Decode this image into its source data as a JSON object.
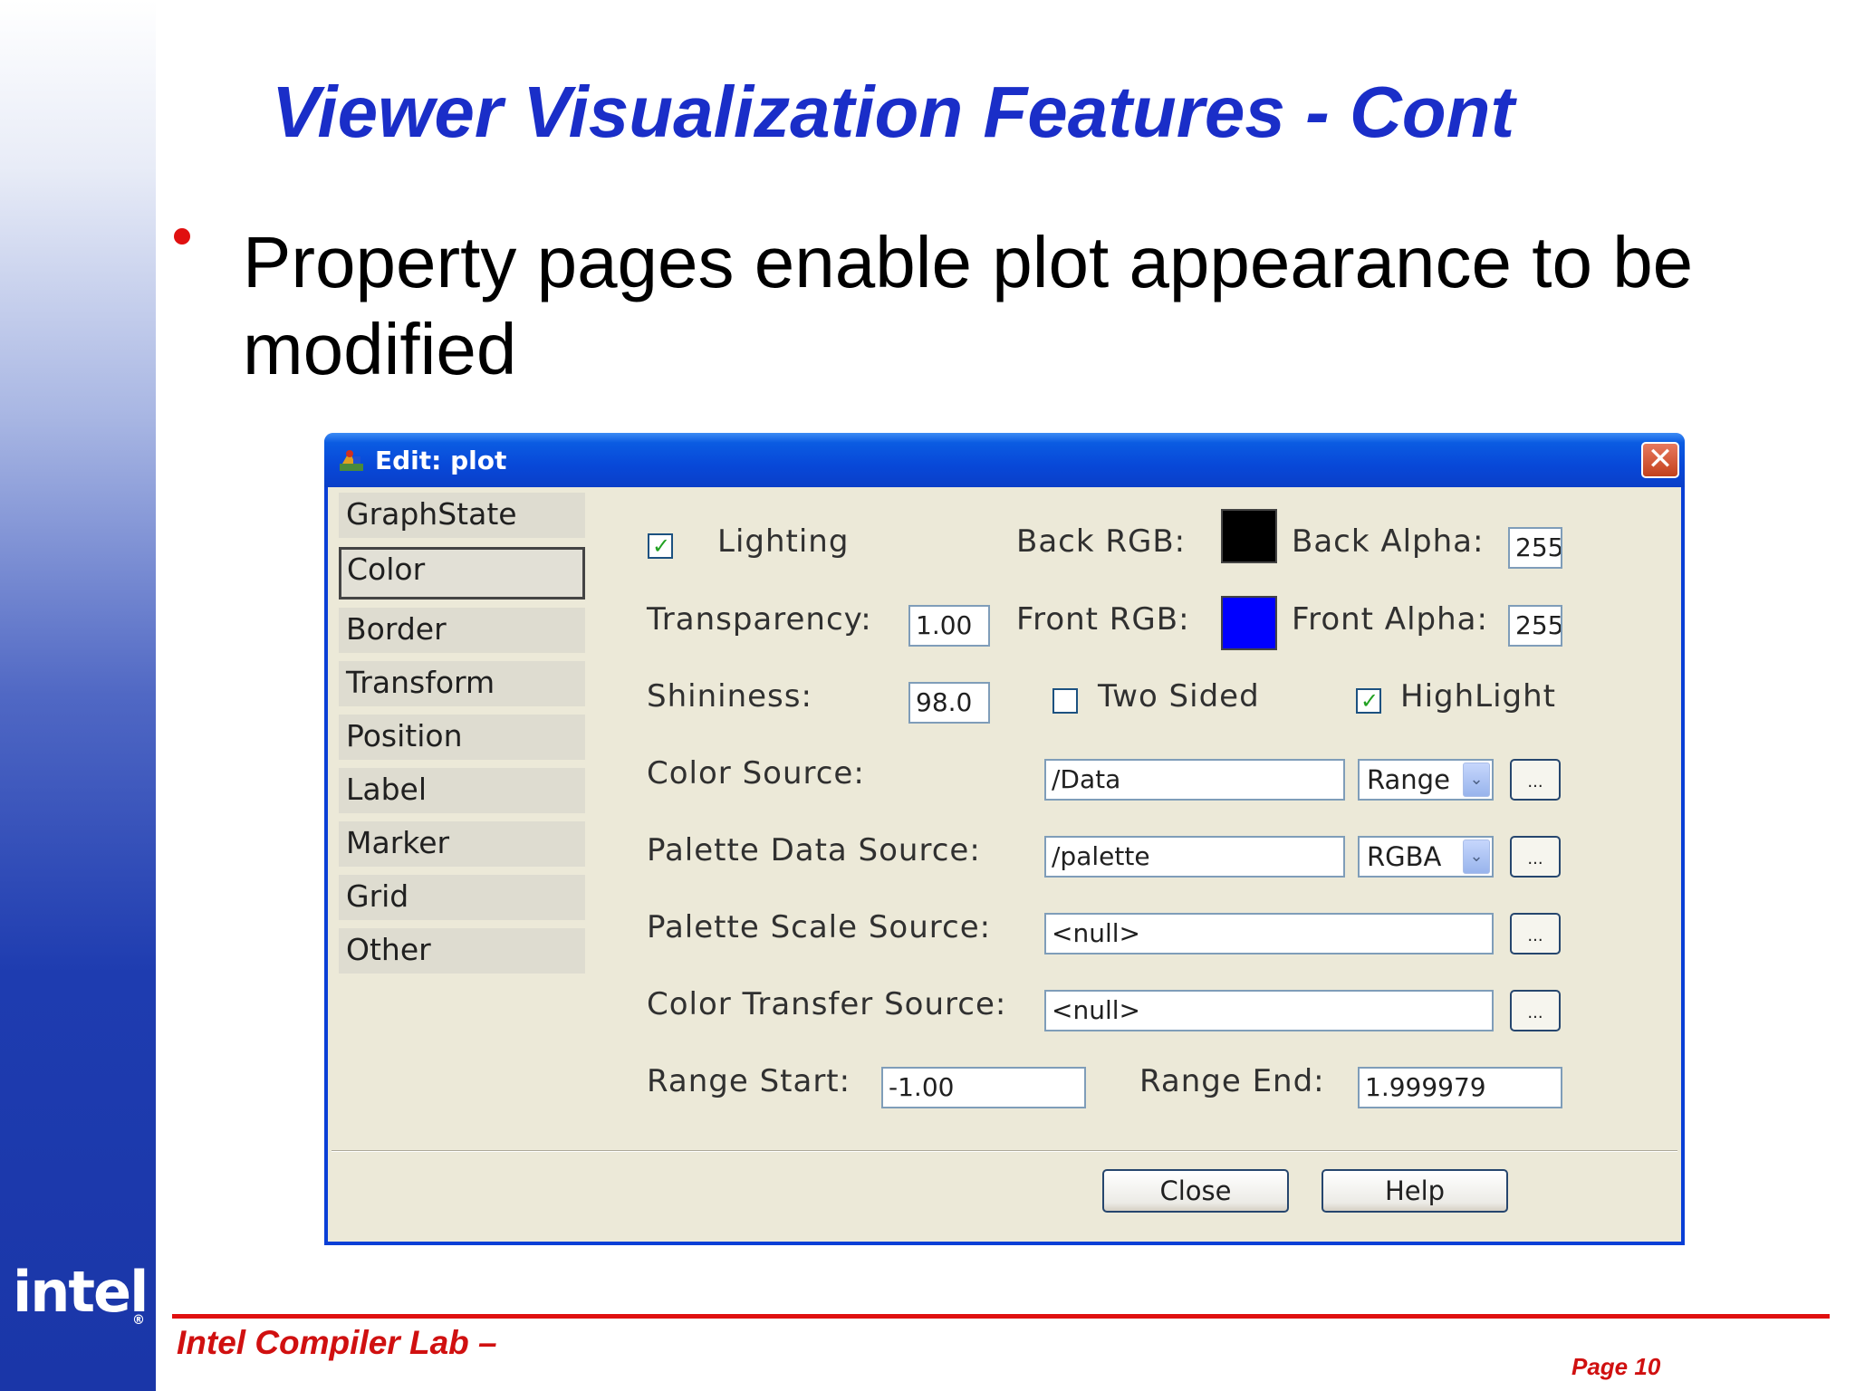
{
  "slide": {
    "title": "Viewer Visualization Features - Cont",
    "bullet": "Property pages enable plot appearance to be modified",
    "footer_left": "Intel Compiler Lab –",
    "footer_page": "Page 10",
    "logo_text": "intel"
  },
  "dialog": {
    "title": "Edit: plot",
    "close_glyph": "✕",
    "nav_items": [
      "GraphState",
      "Color",
      "Border",
      "Transform",
      "Position",
      "Label",
      "Marker",
      "Grid",
      "Other"
    ],
    "selected_nav": "Color",
    "lighting_label": "Lighting",
    "lighting_checked": true,
    "back_rgb_label": "Back RGB:",
    "back_rgb_color": "#000000",
    "back_alpha_label": "Back Alpha:",
    "back_alpha_value": "255",
    "transparency_label": "Transparency:",
    "transparency_value": "1.00",
    "front_rgb_label": "Front RGB:",
    "front_rgb_color": "#0000ff",
    "front_alpha_label": "Front Alpha:",
    "front_alpha_value": "255",
    "shininess_label": "Shininess:",
    "shininess_value": "98.0",
    "two_sided_label": "Two Sided",
    "two_sided_checked": false,
    "highlight_label": "HighLight",
    "highlight_checked": true,
    "color_source_label": "Color Source:",
    "color_source_value": "/Data",
    "color_source_mode": "Range",
    "palette_data_label": "Palette Data Source:",
    "palette_data_value": "/palette",
    "palette_data_mode": "RGBA",
    "palette_scale_label": "Palette Scale Source:",
    "palette_scale_value": "<null>",
    "color_transfer_label": "Color Transfer Source:",
    "color_transfer_value": "<null>",
    "range_start_label": "Range Start:",
    "range_start_value": "-1.00",
    "range_end_label": "Range End:",
    "range_end_value": "1.999979",
    "ellipsis": "...",
    "check_glyph": "✓",
    "dropdown_glyph": "⌄",
    "close_button": "Close",
    "help_button": "Help"
  }
}
